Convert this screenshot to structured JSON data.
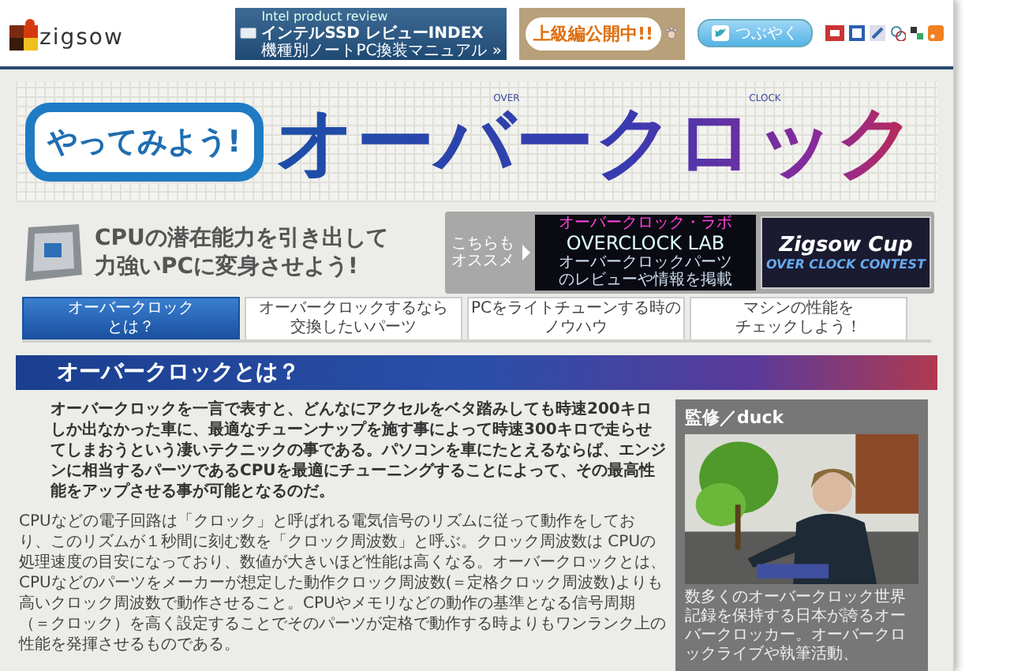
{
  "header": {
    "logo": "zigsow",
    "banners": [
      {
        "kind": "intel",
        "lines": [
          "Intel product review",
          "インテルSSD レビューINDEX",
          "機種別ノートPC換装マニュアル »"
        ]
      },
      {
        "kind": "notice",
        "lines": [
          "上級編公開中!!"
        ]
      }
    ],
    "tweet_button": "つぶやく"
  },
  "hero": {
    "badge": "やってみよう!",
    "title": "オーバークロック",
    "marks": [
      "OVER",
      "CLOCK"
    ]
  },
  "intro": {
    "lines": [
      "CPUの潜在能力を引き出して",
      "力強いPCに変身させよう!"
    ]
  },
  "recommend": {
    "label_lines": [
      "こちらも",
      "オススメ"
    ],
    "banners": [
      {
        "kind": "lab",
        "lines": [
          "オーバークロック・ラボ",
          "OVERCLOCK LAB",
          "オーバークロックパーツのレビューや情報を掲載"
        ]
      },
      {
        "kind": "cup",
        "lines": [
          "Zigsow Cup",
          "OVER CLOCK CONTEST"
        ]
      }
    ]
  },
  "tabs": [
    {
      "lines": [
        "オーバークロック",
        "とは？"
      ],
      "selected": true
    },
    {
      "lines": [
        "オーバークロックするなら",
        "交換したいパーツ"
      ],
      "selected": false
    },
    {
      "lines": [
        "PCをライトチューンする時の",
        "ノウハウ"
      ],
      "selected": false
    },
    {
      "lines": [
        "マシンの性能を",
        "チェックしよう！"
      ],
      "selected": false
    }
  ],
  "section": {
    "title": "オーバークロックとは？",
    "lead": "オーバークロックを一言で表すと、どんなにアクセルをベタ踏みしても時速200キロしか出なかった車に、最適なチューンナップを施す事によって時速300キロで走らせてしまおうという凄いテクニックの事である。パソコンを車にたとえるならば、エンジンに相当するパーツであるCPUを最適にチューニングすることによって、その最高性能をアップさせる事が可能となるのだ。",
    "body": "CPUなどの電子回路は「クロック」と呼ばれる電気信号のリズムに従って動作をしており、このリズムが１秒間に刻む数を「クロック周波数」と呼ぶ。クロック周波数は CPUの処理速度の目安になっており、数値が大きいほど性能は高くなる。オーバークロックとは、CPUなどのパーツをメーカーが想定した動作クロック周波数(＝定格クロック周波数)よりも高いクロック周波数で動作させること。CPUやメモリなどの動作の基準となる信号周期（＝クロック）を高く設定することでそのパーツが定格で動作する時よりもワンランク上の性能を発揮させるものである。"
  },
  "sidebar": {
    "title": "監修／duck",
    "caption": "数多くのオーバークロック世界記録を保持する日本が誇るオーバークロッカー。オーバークロックライブや執筆活動、"
  }
}
